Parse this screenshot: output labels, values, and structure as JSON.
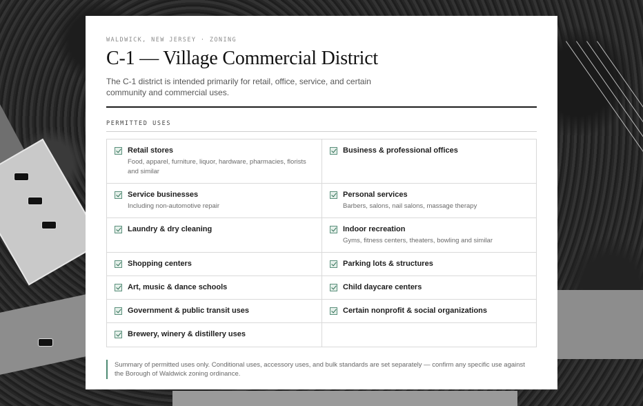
{
  "header": {
    "eyebrow": "WALDWICK, NEW JERSEY · ZONING",
    "title": "C-1 — Village Commercial District",
    "intro": "The C-1 district is intended primarily for retail, office, service, and certain community and commercial uses."
  },
  "permitted": {
    "label": "PERMITTED USES",
    "rows": [
      [
        {
          "name": "Retail stores",
          "desc": "Food, apparel, furniture, liquor, hardware, pharmacies, florists and similar"
        },
        {
          "name": "Business & professional offices",
          "desc": ""
        }
      ],
      [
        {
          "name": "Service businesses",
          "desc": "Including non-automotive repair"
        },
        {
          "name": "Personal services",
          "desc": "Barbers, salons, nail salons, massage therapy"
        }
      ],
      [
        {
          "name": "Laundry & dry cleaning",
          "desc": ""
        },
        {
          "name": "Indoor recreation",
          "desc": "Gyms, fitness centers, theaters, bowling and similar"
        }
      ],
      [
        {
          "name": "Shopping centers",
          "desc": ""
        },
        {
          "name": "Parking lots & structures",
          "desc": ""
        }
      ],
      [
        {
          "name": "Art, music & dance schools",
          "desc": ""
        },
        {
          "name": "Child daycare centers",
          "desc": ""
        }
      ],
      [
        {
          "name": "Government & public transit uses",
          "desc": ""
        },
        {
          "name": "Certain nonprofit & social organizations",
          "desc": ""
        }
      ],
      [
        {
          "name": "Brewery, winery & distillery uses",
          "desc": ""
        },
        null
      ]
    ]
  },
  "footnote": "Summary of permitted uses only. Conditional uses, accessory uses, and bulk standards are set separately — confirm any specific use against the Borough of Waldwick zoning ordinance.",
  "colors": {
    "accent": "#4d8a72",
    "check_fill": "#e5f0ea"
  },
  "icons": {
    "check": "checkbox-checked-icon"
  }
}
